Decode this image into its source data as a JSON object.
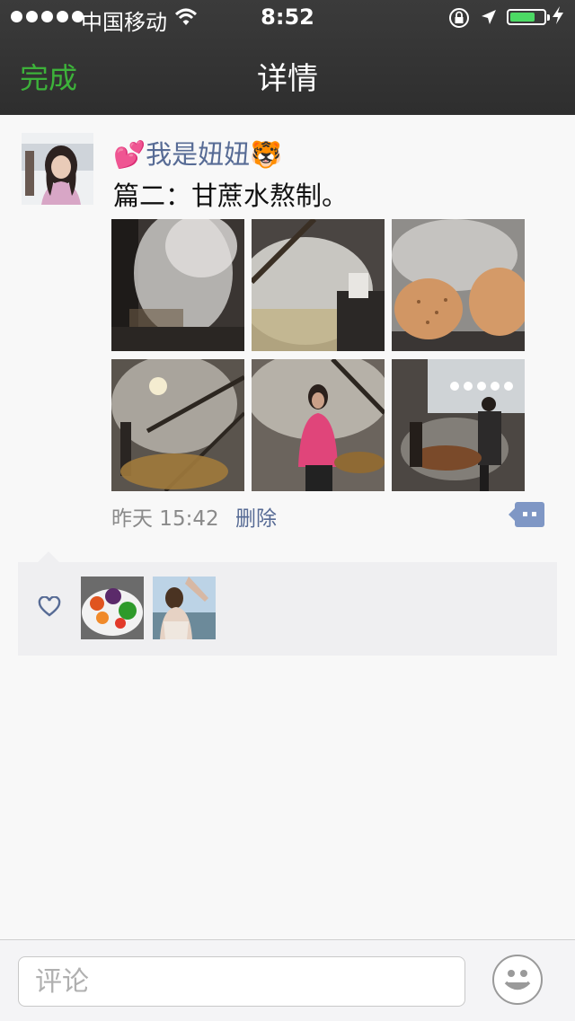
{
  "status_bar": {
    "carrier": "中国移动",
    "time": "8:52",
    "battery_level": 0.75
  },
  "nav": {
    "title": "详情",
    "done_label": "完成"
  },
  "post": {
    "username": "我是妞妞",
    "username_emoji_before": "💕",
    "username_emoji_after": "🐯",
    "text": "篇二：甘蔗水熬制。",
    "timestamp": "昨天 15:42",
    "delete_label": "删除",
    "photo_count": 6
  },
  "likes": {
    "liker_count": 2
  },
  "comment": {
    "placeholder": "评论"
  },
  "colors": {
    "nav_background": "#333333",
    "accent_green": "#3db23a",
    "link_blue": "#576b95",
    "battery_green": "#4cd964"
  },
  "icons": [
    "wifi-icon",
    "orientation-lock-icon",
    "location-arrow-icon",
    "battery-icon",
    "comment-bubble-icon",
    "heart-icon",
    "emoji-icon"
  ]
}
